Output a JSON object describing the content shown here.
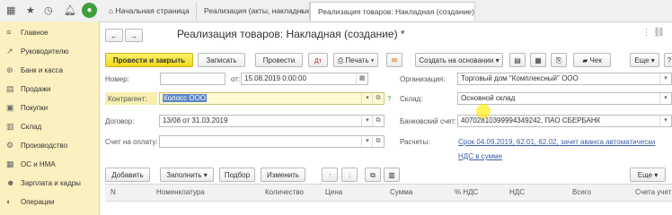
{
  "topbar": {
    "icons": [
      "grid-icon",
      "star-icon",
      "history-icon",
      "bell-icon",
      "avatar-icon"
    ],
    "tabs": [
      {
        "label": "Начальная страница"
      },
      {
        "label": "Реализация (акты, накладные)"
      },
      {
        "label": "Реализация товаров: Накладная (создание) *"
      }
    ]
  },
  "sidebar": {
    "items": [
      {
        "label": "Главное",
        "icon": "menu-icon"
      },
      {
        "label": "Руководителю",
        "icon": "chart-icon"
      },
      {
        "label": "Банк и касса",
        "icon": "bank-icon"
      },
      {
        "label": "Продажи",
        "icon": "sales-icon"
      },
      {
        "label": "Покупки",
        "icon": "cart-icon"
      },
      {
        "label": "Склад",
        "icon": "warehouse-icon"
      },
      {
        "label": "Производство",
        "icon": "factory-icon"
      },
      {
        "label": "ОС и НМА",
        "icon": "assets-icon"
      },
      {
        "label": "Зарплата и кадры",
        "icon": "people-icon"
      },
      {
        "label": "Операции",
        "icon": "operations-icon"
      }
    ]
  },
  "doc": {
    "title": "Реализация товаров: Накладная (создание) *",
    "toolbar": {
      "post_close": "Провести и закрыть",
      "save": "Записать",
      "post": "Провести",
      "print": "Печать",
      "create_based": "Создать на основании",
      "check": "Чек",
      "more": "Еще"
    },
    "fields": {
      "number_label": "Номер:",
      "number_value": "",
      "date_label": "от:",
      "date_value": "15.08.2019  0:00:00",
      "org_label": "Организация:",
      "org_value": "Торговый дом \"Комплексный\" ООО",
      "contractor_label": "Контрагент:",
      "contractor_value": "Колосс ООО",
      "warehouse_label": "Склад:",
      "warehouse_value": "Основной склад",
      "contract_label": "Договор:",
      "contract_value": "13/08 от 31.03.2019",
      "bank_label": "Банковский счет:",
      "bank_value": "40702810399994349242, ПАО СБЕРБАНК",
      "invoice_label": "Счет на оплату:",
      "invoice_value": "",
      "payments_label": "Расчеты:",
      "payments_link": "Срок 04.09.2019, 62.01, 62.02, зачет аванса автоматически",
      "vat_link": "НДС в сумме"
    },
    "grid_toolbar": {
      "add": "Добавить",
      "fill": "Заполнить",
      "select": "Подбор",
      "change": "Изменить"
    },
    "columns": [
      "N",
      "Номенклатура",
      "Количество",
      "Цена",
      "Сумма",
      "% НДС",
      "НДС",
      "Всего",
      "Счета учет"
    ]
  },
  "colors": {
    "sidebar_bg": "#fbf0c0",
    "primary_button": "#f3d91a",
    "link": "#3a5fa8"
  }
}
